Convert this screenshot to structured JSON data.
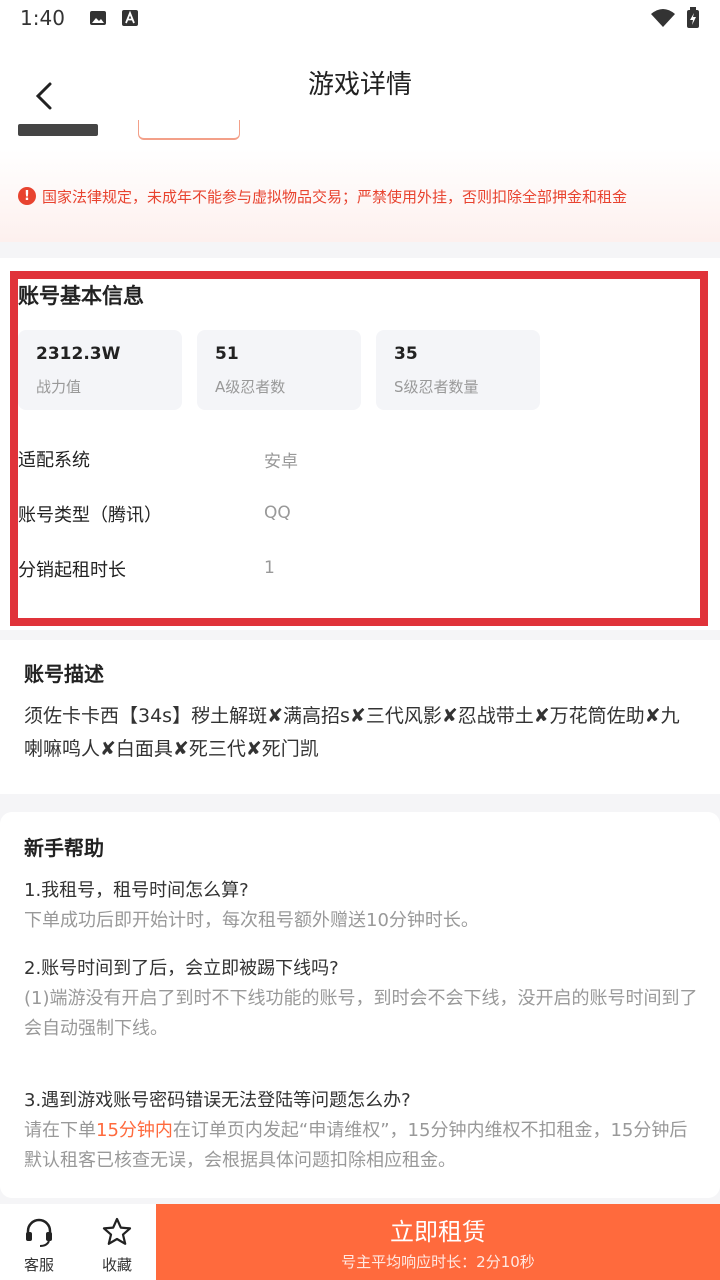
{
  "status_bar": {
    "time": "1:40"
  },
  "header": {
    "title": "游戏详情"
  },
  "notice": {
    "text": "国家法律规定，未成年不能参与虚拟物品交易；严禁使用外挂，否则扣除全部押金和租金"
  },
  "basic_info": {
    "title": "账号基本信息",
    "stats": [
      {
        "value": "2312.3W",
        "label": "战力值"
      },
      {
        "value": "51",
        "label": "A级忍者数"
      },
      {
        "value": "35",
        "label": "S级忍者数量"
      }
    ],
    "rows": [
      {
        "label": "适配系统",
        "value": "安卓"
      },
      {
        "label": "账号类型（腾讯）",
        "value": "QQ"
      },
      {
        "label": "分销起租时长",
        "value": "1"
      }
    ]
  },
  "description": {
    "title": "账号描述",
    "text": "须佐卡卡西【34s】秽土解斑✘满高招s✘三代风影✘忍战带土✘万花筒佐助✘九喇嘛鸣人✘白面具✘死三代✘死门凯"
  },
  "help": {
    "title": "新手帮助",
    "items": [
      {
        "q": "1.我租号，租号时间怎么算?",
        "a": "下单成功后即开始计时，每次租号额外赠送10分钟时长。"
      },
      {
        "q": "2.账号时间到了后，会立即被踢下线吗?",
        "a": "(1)端游没有开启了到时不下线功能的账号，到时会不会下线，没开启的账号时间到了会自动强制下线。"
      },
      {
        "q": "3.遇到游戏账号密码错误无法登陆等问题怎么办?",
        "a_pre": "请在下单",
        "a_hl": "15分钟内",
        "a_post": "在订单页内发起“申请维权”，15分钟内维权不扣租金，15分钟后默认租客已核查无误，会根据具体问题扣除相应租金。"
      }
    ]
  },
  "bottom_bar": {
    "service_label": "客服",
    "favorite_label": "收藏",
    "rent_label": "立即租赁",
    "rent_sub": "号主平均响应时长：2分10秒"
  },
  "colors": {
    "accent": "#ff6a3d",
    "warning": "#e8432f",
    "highlight_frame": "#e0333a"
  }
}
